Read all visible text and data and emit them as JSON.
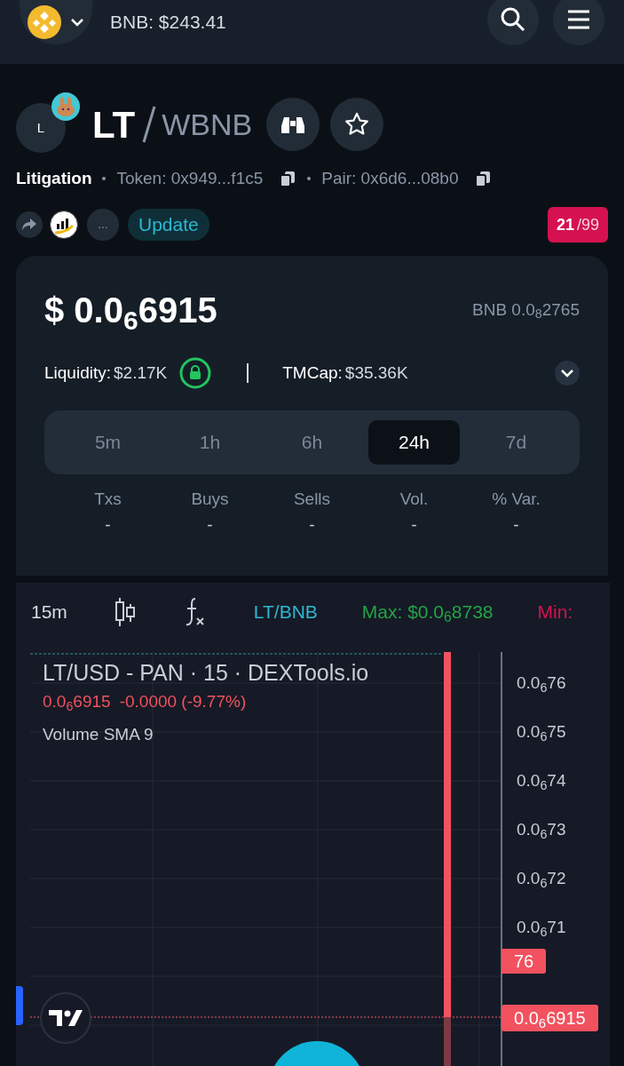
{
  "header": {
    "price": "BNB: $243.41"
  },
  "token": {
    "avatar_letter": "L",
    "symbol": "LT",
    "quote": "WBNB",
    "name": "Litigation",
    "token_address": "Token: 0x949...f1c5",
    "pair_address": "Pair: 0x6d6...08b0",
    "more_button": "...",
    "update_button": "Update",
    "score": "21",
    "score_max": "/99"
  },
  "price_card": {
    "price_usd": "$ 0.0$_{6}$6915",
    "price_bnb": "BNB 0.0$_{8}$2765",
    "liquidity_label": "Liquidity:",
    "liquidity_value": "$2.17K",
    "liquidity_locked": true,
    "tmcap_label": "TMCap:",
    "tmcap_value": "$35.36K",
    "periods": [
      {
        "label": "5m",
        "selected": false
      },
      {
        "label": "1h",
        "selected": false
      },
      {
        "label": "6h",
        "selected": false
      },
      {
        "label": "24h",
        "selected": true
      },
      {
        "label": "7d",
        "selected": false
      }
    ],
    "stats": [
      {
        "label": "Txs",
        "value": "-"
      },
      {
        "label": "Buys",
        "value": "-"
      },
      {
        "label": "Sells",
        "value": "-"
      },
      {
        "label": "Vol.",
        "value": "-"
      },
      {
        "label": "% Var.",
        "value": "-"
      }
    ]
  },
  "chart": {
    "interval": "15m",
    "pair_button": "LT/BNB",
    "max": "Max: $0.0$_{6}$8738",
    "min": "Min:",
    "title": "LT/USD - PAN · 15 · DEXTools.io",
    "last_price": "0.0$_{6}$6915",
    "change": "-0.0000 (-9.77%)",
    "indicator": "Volume SMA 9",
    "axis_labels": [
      "0.0$_{6}$76",
      "0.0$_{6}$75",
      "0.0$_{6}$74",
      "0.0$_{6}$73",
      "0.0$_{6}$72",
      "0.0$_{6}$71"
    ],
    "badge_high": "76",
    "badge_price": "0.0$_{6}$6915"
  }
}
